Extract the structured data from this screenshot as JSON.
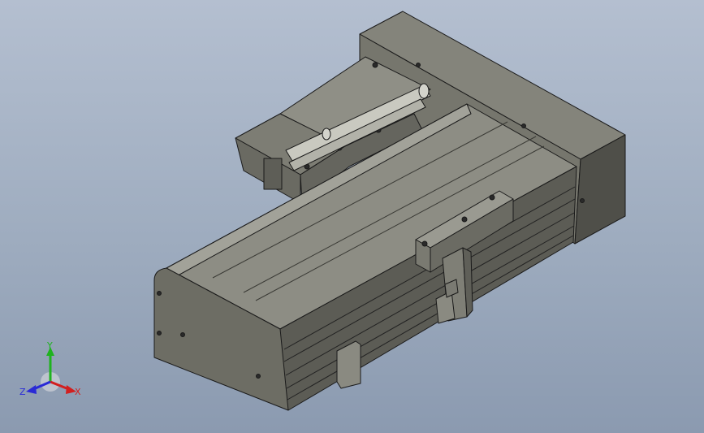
{
  "viewport": {
    "background_top": "#b4bfd0",
    "background_bottom": "#8b9ab0",
    "model_face_color": "#6f6f66",
    "model_edge_color": "#1a1a1a"
  },
  "triad": {
    "x_label": "X",
    "y_label": "Y",
    "z_label": "Z",
    "x_color": "#d21f1f",
    "y_color": "#1fb31f",
    "z_color": "#2a2ad6"
  }
}
